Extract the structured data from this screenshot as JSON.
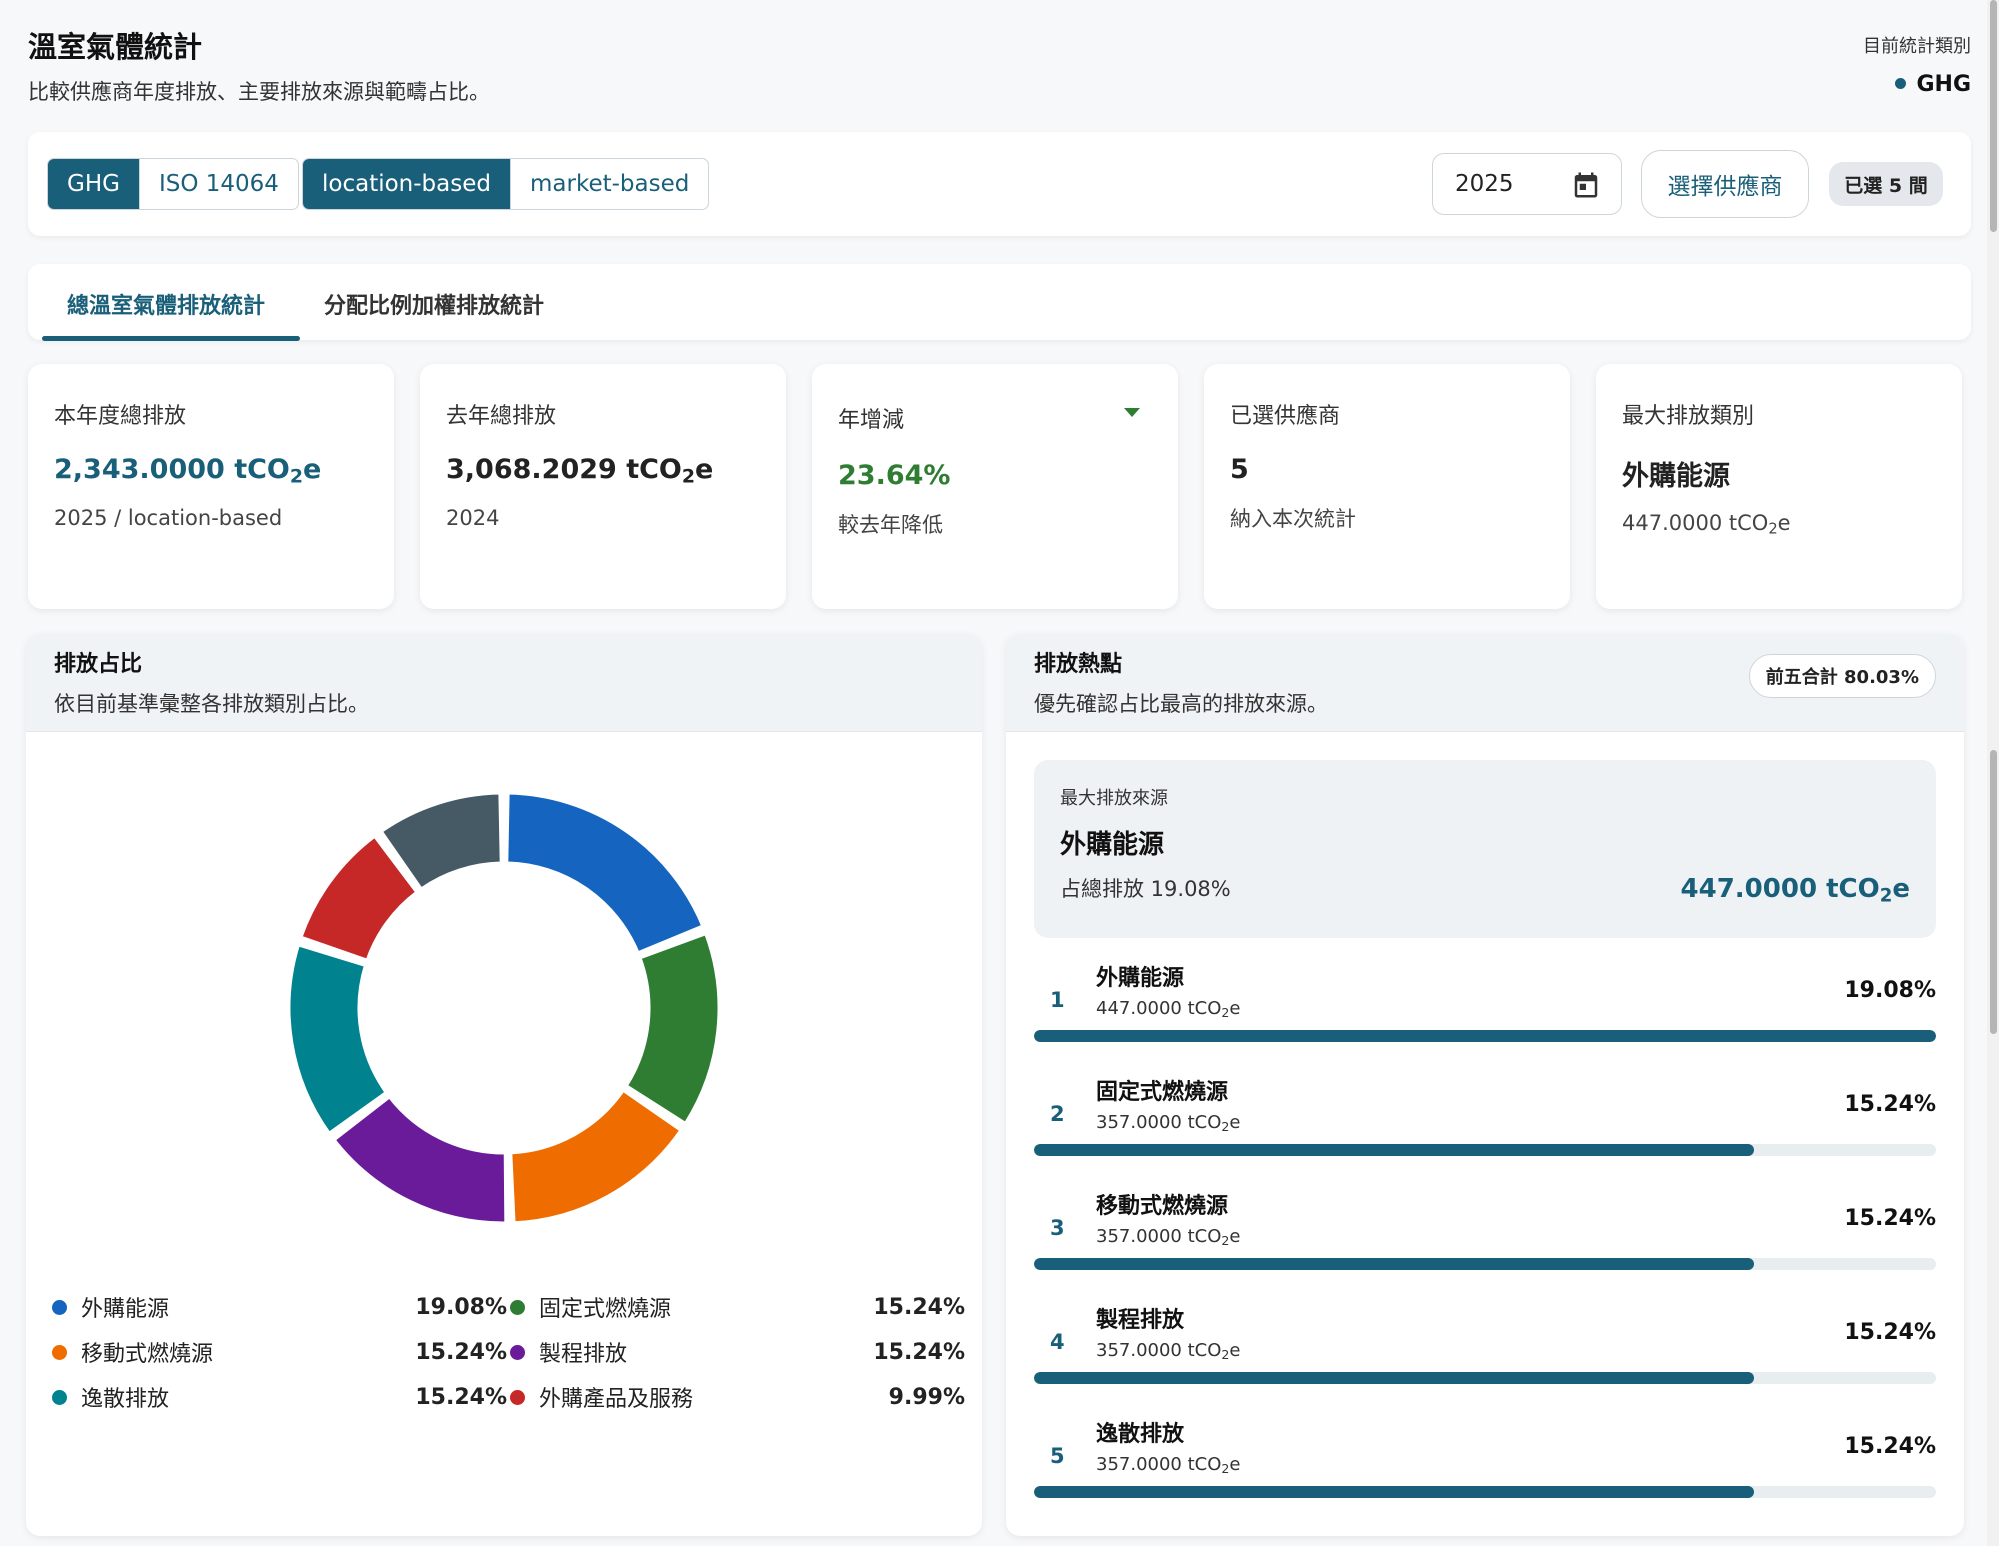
{
  "header": {
    "title": "溫室氣體統計",
    "subtitle": "比較供應商年度排放、主要排放來源與範疇占比。",
    "standard_label": "目前統計類別",
    "standard_value": "GHG"
  },
  "filters": {
    "standard_options": [
      "GHG",
      "ISO 14064"
    ],
    "standard_active": "GHG",
    "method_options": [
      "location-based",
      "market-based"
    ],
    "method_active": "location-based",
    "year": "2025",
    "select_supplier_label": "選擇供應商",
    "selected_count_label": "已選 5 間"
  },
  "tabs": [
    {
      "label": "總溫室氣體排放統計",
      "active": true
    },
    {
      "label": "分配比例加權排放統計",
      "active": false
    }
  ],
  "kpis": {
    "current": {
      "label": "本年度總排放",
      "value": "2,343.0000 tCO",
      "unit_sub": "2",
      "unit_tail": "e",
      "sub": "2025 / location-based"
    },
    "previous": {
      "label": "去年總排放",
      "value": "3,068.2029 tCO",
      "unit_sub": "2",
      "unit_tail": "e",
      "sub": "2024"
    },
    "change": {
      "label": "年增減",
      "value": "23.64%",
      "sub": "較去年降低",
      "trend": "down"
    },
    "suppliers": {
      "label": "已選供應商",
      "value": "5",
      "sub": "納入本次統計"
    },
    "top_category": {
      "label": "最大排放類別",
      "value": "外購能源",
      "sub": "447.0000 tCO",
      "unit_sub": "2",
      "unit_tail": "e"
    }
  },
  "share_panel": {
    "title": "排放占比",
    "description": "依目前基準彙整各排放類別占比。"
  },
  "hotspot_panel": {
    "title": "排放熱點",
    "description": "優先確認占比最高的排放來源。",
    "total_badge": "前五合計 80.03%",
    "top_source": {
      "label": "最大排放來源",
      "name": "外購能源",
      "share": "占總排放 19.08%",
      "value": "447.0000 tCO",
      "unit_sub": "2",
      "unit_tail": "e"
    },
    "ranking": [
      {
        "rank": "1",
        "name": "外購能源",
        "value": "447.0000 tCO",
        "pct": "19.08%",
        "bar": 1.0
      },
      {
        "rank": "2",
        "name": "固定式燃燒源",
        "value": "357.0000 tCO",
        "pct": "15.24%",
        "bar": 0.7987
      },
      {
        "rank": "3",
        "name": "移動式燃燒源",
        "value": "357.0000 tCO",
        "pct": "15.24%",
        "bar": 0.7987
      },
      {
        "rank": "4",
        "name": "製程排放",
        "value": "357.0000 tCO",
        "pct": "15.24%",
        "bar": 0.7987
      },
      {
        "rank": "5",
        "name": "逸散排放",
        "value": "357.0000 tCO",
        "pct": "15.24%",
        "bar": 0.7987
      }
    ]
  },
  "chart_data": {
    "type": "pie",
    "categories": [
      "外購能源",
      "固定式燃燒源",
      "移動式燃燒源",
      "製程排放",
      "逸散排放",
      "外購產品及服務"
    ],
    "values": [
      19.08,
      15.24,
      15.24,
      15.24,
      15.24,
      9.99
    ],
    "labels": [
      "19.08%",
      "15.24%",
      "15.24%",
      "15.24%",
      "15.24%",
      "9.99%"
    ],
    "colors": [
      "#1565c0",
      "#2e7d32",
      "#ef6c00",
      "#6a1b9a",
      "#00838f",
      "#c62828"
    ],
    "extra_segment": {
      "value": 9.97,
      "color": "#455a64"
    }
  }
}
